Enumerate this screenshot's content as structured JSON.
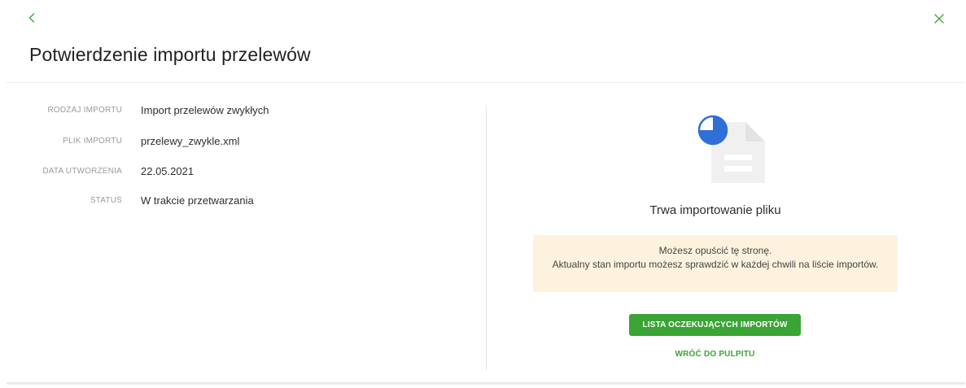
{
  "header": {
    "back_icon": "chevron-left-icon",
    "close_icon": "close-icon",
    "title": "Potwierdzenie importu przelewów"
  },
  "details": {
    "rows": [
      {
        "label": "RODZAJ IMPORTU",
        "value": "Import przelewów zwykłych"
      },
      {
        "label": "PLIK IMPORTU",
        "value": "przelewy_zwykle.xml"
      },
      {
        "label": "DATA UTWORZENIA",
        "value": "22.05.2021"
      },
      {
        "label": "STATUS",
        "value": "W trakcie przetwarzania"
      }
    ]
  },
  "status_panel": {
    "icon": "document-progress-icon",
    "heading": "Trwa importowanie pliku",
    "info_line1": "Możesz opuścić tę stronę.",
    "info_line2": "Aktualny stan importu możesz sprawdzić w każdej chwili na liście importów.",
    "primary_button_label": "LISTA OCZEKUJĄCYCH IMPORTÓW",
    "secondary_link_label": "WRÓĆ DO PULPITU"
  },
  "colors": {
    "accent": "#3aa435",
    "info_bg": "#fcf2dd",
    "progress": "#2f6fd6"
  }
}
